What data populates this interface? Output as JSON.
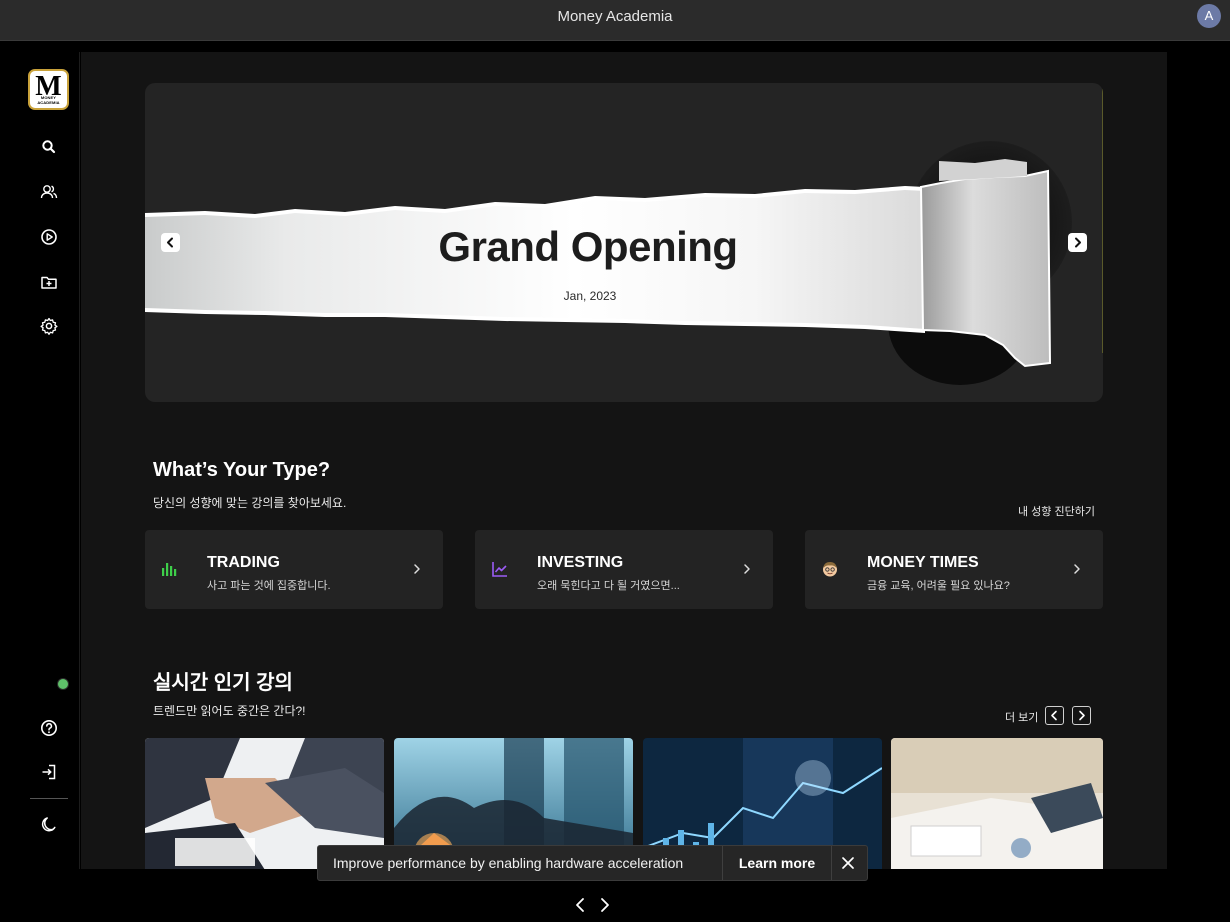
{
  "window": {
    "title": "Money Academia",
    "avatar_letter": "A"
  },
  "sidebar": {
    "logo_letters": "M",
    "logo_sub": "MONEY ACADEMIA",
    "icons": [
      "search-icon",
      "users-icon",
      "play-circle-icon",
      "folder-plus-icon",
      "settings-icon",
      "help-icon",
      "logout-icon",
      "moon-icon"
    ]
  },
  "banner": {
    "headline": "Grand Opening",
    "date": "Jan, 2023"
  },
  "type_section": {
    "title": "What’s Your Type?",
    "subtitle": "당신의 성향에 맞는 강의를 찾아보세요.",
    "link": "내 성향 진단하기",
    "cards": [
      {
        "name": "TRADING",
        "desc": "사고 파는 것에 집중합니다.",
        "icon": "bar-chart-icon",
        "color": "#3ecf4a"
      },
      {
        "name": "INVESTING",
        "desc": "오래 묵힌다고 다 될 거였으면...",
        "icon": "line-chart-icon",
        "color": "#9b5cf6"
      },
      {
        "name": "MONEY TIMES",
        "desc": "금융 교육, 어려울 필요 있나요?",
        "icon": "emoji-face-icon",
        "color": "#f2c9a0"
      }
    ]
  },
  "popular_section": {
    "title": "실시간 인기 강의",
    "subtitle": "트렌드만 읽어도 중간은 간다?!",
    "more_label": "더 보기"
  },
  "toast": {
    "message": "Improve performance by enabling hardware acceleration",
    "action": "Learn more"
  }
}
